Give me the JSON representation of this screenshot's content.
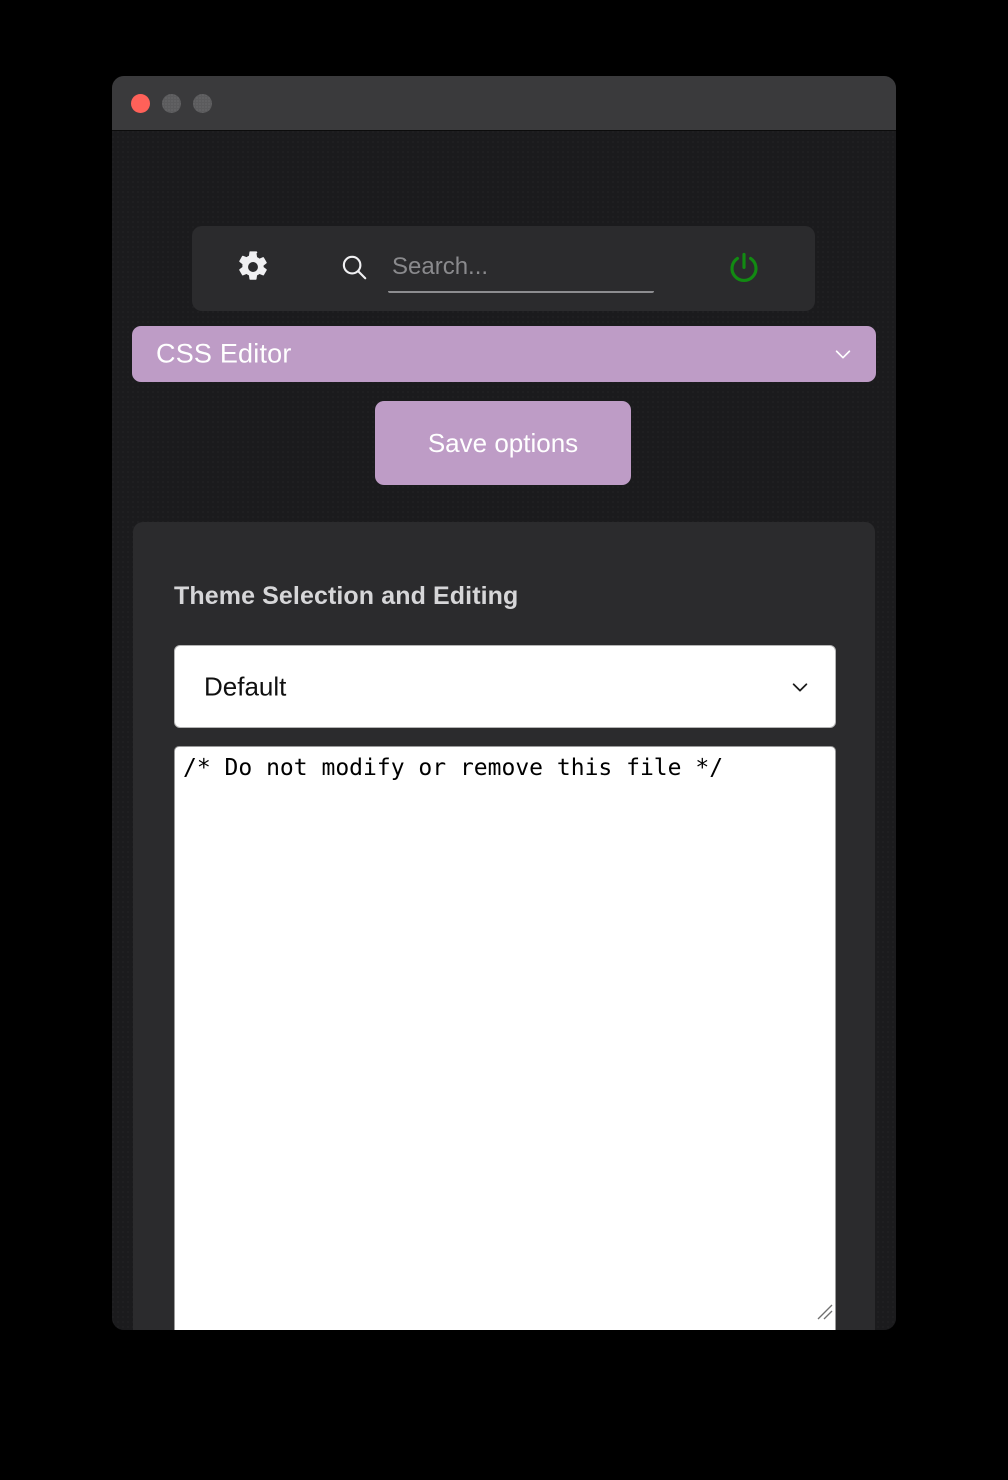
{
  "window": {
    "titlebar": {
      "close_label": "close",
      "minimize_label": "minimize",
      "zoom_label": "zoom"
    }
  },
  "toolbar": {
    "gear_icon": "gear-icon",
    "search_icon": "search-icon",
    "power_icon": "power-icon",
    "search": {
      "value": "",
      "placeholder": "Search..."
    },
    "power_color": "#128a12"
  },
  "section_selector": {
    "selected": "CSS Editor",
    "chevron_icon": "chevron-down-icon",
    "accent_color": "#be9cc6",
    "text_color": "#ffffff"
  },
  "actions": {
    "save_options_label": "Save options"
  },
  "content": {
    "heading": "Theme Selection and Editing",
    "theme_select": {
      "selected": "Default",
      "chevron_icon": "chevron-down-icon"
    },
    "css_editor": {
      "value": "/* Do not modify or remove this file */",
      "resize_grip_icon": "resize-grip-icon"
    }
  },
  "colors": {
    "window_background": "#1b1b1d",
    "titlebar": "#3a3a3c",
    "panel": "#2b2b2d",
    "accent_purple": "#be9cc6",
    "traffic_close": "#ff6159",
    "traffic_inactive": "#5b5b5d",
    "power_green": "#128a12",
    "heading_text": "#d6d6d8",
    "placeholder_text": "#8a8a8d"
  }
}
